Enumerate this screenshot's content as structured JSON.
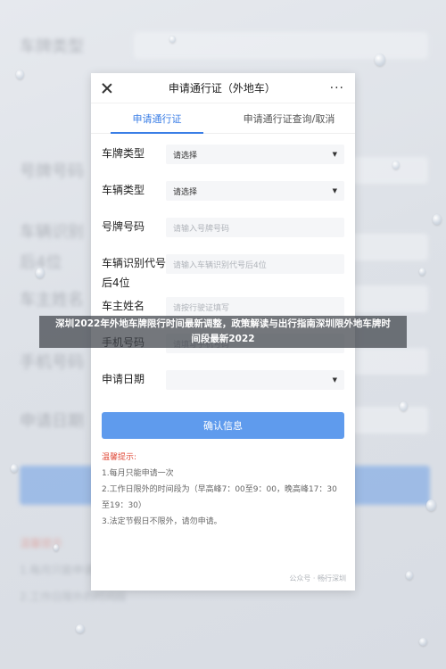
{
  "window": {
    "title": "申请通行证（外地车）",
    "close_icon": "close-icon",
    "more_icon": "more-icon",
    "more_glyph": "···"
  },
  "tabs": [
    {
      "label": "申请通行证",
      "active": true
    },
    {
      "label": "申请通行证查询/取消",
      "active": false
    }
  ],
  "form": {
    "fields": [
      {
        "label": "车牌类型",
        "value": "请选择",
        "type": "select"
      },
      {
        "label": "车辆类型",
        "value": "请选择",
        "type": "select"
      },
      {
        "label": "号牌号码",
        "placeholder": "请输入号牌号码",
        "type": "input"
      },
      {
        "label": "车辆识别代号后4位",
        "placeholder": "请输入车辆识别代号后4位",
        "type": "input"
      },
      {
        "label": "车主姓名",
        "placeholder": "请按行驶证填写",
        "type": "input"
      },
      {
        "label": "手机号码",
        "placeholder": "请填写手机号码",
        "type": "input"
      },
      {
        "label": "申请日期",
        "value": "",
        "type": "select"
      }
    ],
    "submit_label": "确认信息"
  },
  "tips": {
    "title": "温馨提示:",
    "items": [
      "1.每月只能申请一次",
      "2.工作日限外的时间段为（早高峰7：00至9：00，晚高峰17：30至19：30）",
      "3.法定节假日不限外，请勿申请。"
    ]
  },
  "watermark": "公众号 · 畅行深圳",
  "banner": {
    "line1": "深圳2022年外地车牌限行时间最新调整，政策解读与出行指南深圳限外地车牌时",
    "line2": "间段最新2022"
  },
  "colors": {
    "accent": "#3a7ee6",
    "button": "#5f9bed",
    "tips_title": "#e04b3a",
    "banner_bg": "#3e424a"
  }
}
